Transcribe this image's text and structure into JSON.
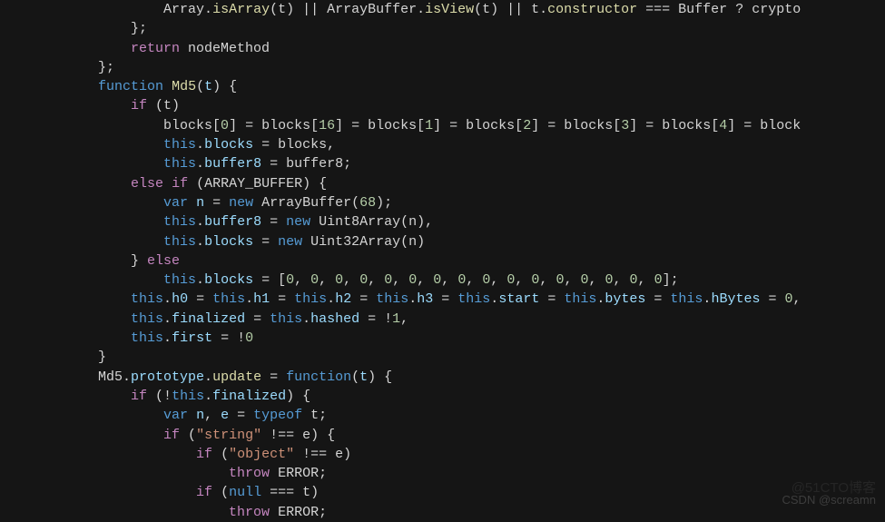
{
  "watermark_top": "@51CTO博客",
  "watermark_bottom": "CSDN @screamn",
  "code": {
    "l01": {
      "a": "                    Array",
      "b": ".",
      "c": "isArray",
      "d": "(t) || ArrayBuffer.",
      "e": "isView",
      "f": "(t) || t.",
      "g": "constructor",
      "h": " === Buffer ? crypto"
    },
    "l02": "                };",
    "l03": {
      "a": "                ",
      "b": "return",
      "c": " nodeMethod"
    },
    "l04": "            };",
    "l05": {
      "a": "            ",
      "b": "function",
      "c": " ",
      "d": "Md5",
      "e": "(",
      "f": "t",
      "g": ") {"
    },
    "l06": {
      "a": "                ",
      "b": "if",
      "c": " (t)"
    },
    "l07": {
      "a": "                    blocks[",
      "n0": "0",
      "b": "] = blocks[",
      "n16": "16",
      "c": "] = blocks[",
      "n1": "1",
      "d": "] = blocks[",
      "n2": "2",
      "e": "] = blocks[",
      "n3": "3",
      "f": "] = blocks[",
      "n4": "4",
      "g": "] = block"
    },
    "l08": {
      "a": "                    ",
      "b": "this",
      "c": ".",
      "d": "blocks",
      "e": " = blocks,"
    },
    "l09": {
      "a": "                    ",
      "b": "this",
      "c": ".",
      "d": "buffer8",
      "e": " = buffer8;"
    },
    "l10": {
      "a": "                ",
      "b": "else",
      "c": " ",
      "d": "if",
      "e": " (ARRAY_BUFFER) {"
    },
    "l11": {
      "a": "                    ",
      "b": "var",
      "c": " ",
      "d": "n",
      "e": " = ",
      "f": "new",
      "g": " ArrayBuffer(",
      "h": "68",
      "i": ");"
    },
    "l12": {
      "a": "                    ",
      "b": "this",
      "c": ".",
      "d": "buffer8",
      "e": " = ",
      "f": "new",
      "g": " Uint8Array(n),"
    },
    "l13": {
      "a": "                    ",
      "b": "this",
      "c": ".",
      "d": "blocks",
      "e": " = ",
      "f": "new",
      "g": " Uint32Array(n)"
    },
    "l14": {
      "a": "                } ",
      "b": "else"
    },
    "l15": {
      "a": "                    ",
      "b": "this",
      "c": ".",
      "d": "blocks",
      "e": " = [",
      "n": "0",
      "s": ", ",
      "z": "];"
    },
    "l16": {
      "a": "                ",
      "b": "this",
      "c": ".",
      "d": "h0",
      "e": " = ",
      "f": "this",
      "g": ".",
      "h": "h1",
      "i": " = ",
      "j": "this",
      "k": ".",
      "l": "h2",
      "m": " = ",
      "n": "this",
      "o": ".",
      "p": "h3",
      "q": " = ",
      "r": "this",
      "s": ".",
      "t": "start",
      "u": " = ",
      "v": "this",
      "w": ".",
      "x": "bytes",
      "y": " = ",
      "z": "this",
      "aa": ".",
      "ab": "hBytes",
      "ac": " = ",
      "ad": "0",
      "ae": ","
    },
    "l17": {
      "a": "                ",
      "b": "this",
      "c": ".",
      "d": "finalized",
      "e": " = ",
      "f": "this",
      "g": ".",
      "h": "hashed",
      "i": " = !",
      "j": "1",
      "k": ","
    },
    "l18": {
      "a": "                ",
      "b": "this",
      "c": ".",
      "d": "first",
      "e": " = !",
      "f": "0"
    },
    "l19": "            }",
    "l20": {
      "a": "            Md5.",
      "b": "prototype",
      "c": ".",
      "d": "update",
      "e": " = ",
      "f": "function",
      "g": "(",
      "h": "t",
      "i": ") {"
    },
    "l21": {
      "a": "                ",
      "b": "if",
      "c": " (!",
      "d": "this",
      "e": ".",
      "f": "finalized",
      "g": ") {"
    },
    "l22": {
      "a": "                    ",
      "b": "var",
      "c": " ",
      "d": "n",
      "e": ", ",
      "f": "e",
      "g": " = ",
      "h": "typeof",
      "i": " t;"
    },
    "l23": {
      "a": "                    ",
      "b": "if",
      "c": " (",
      "d": "\"string\"",
      "e": " !== e) {"
    },
    "l24": {
      "a": "                        ",
      "b": "if",
      "c": " (",
      "d": "\"object\"",
      "e": " !== e)"
    },
    "l25": {
      "a": "                            ",
      "b": "throw",
      "c": " ERROR;"
    },
    "l26": {
      "a": "                        ",
      "b": "if",
      "c": " (",
      "d": "null",
      "e": " === t)"
    },
    "l27": {
      "a": "                            ",
      "b": "throw",
      "c": " ERROR;"
    }
  }
}
